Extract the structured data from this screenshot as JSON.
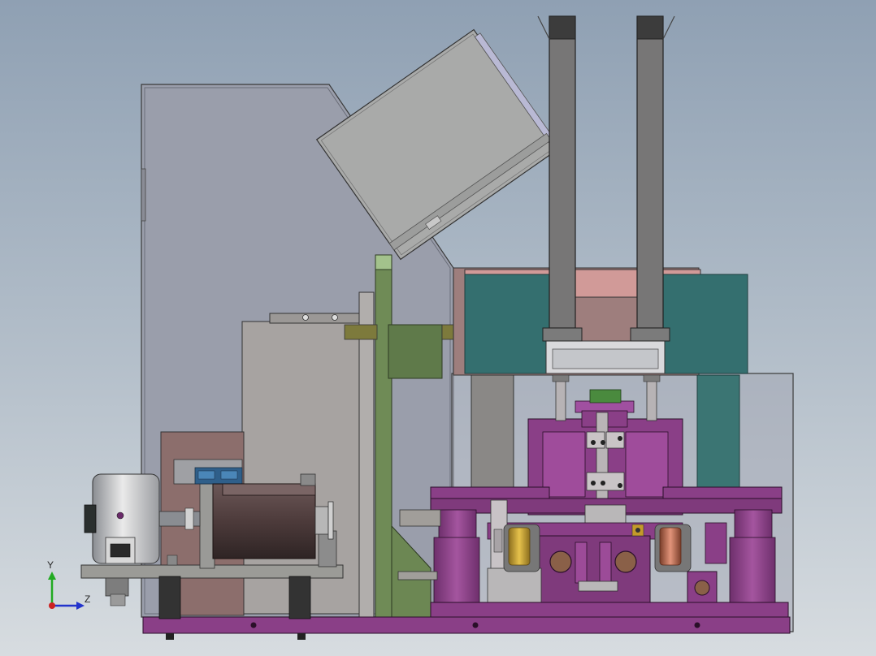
{
  "colors": {
    "background_top": "#8fa0b3",
    "background_bottom": "#d7dce0",
    "enclosure": "#979aa7",
    "purple_frame": "#8a3f87",
    "teal_block": "#346f6f",
    "olive_rail": "#6f8b56",
    "motor_body": "#4d3d3d",
    "brass_coil": "#c9a43b",
    "copper_coil": "#b56a4e",
    "axis_x": "#2233cc",
    "axis_y": "#22aa22",
    "axis_z": "#2233cc"
  },
  "triad": {
    "y_label": "Y",
    "z_label": "Z"
  }
}
